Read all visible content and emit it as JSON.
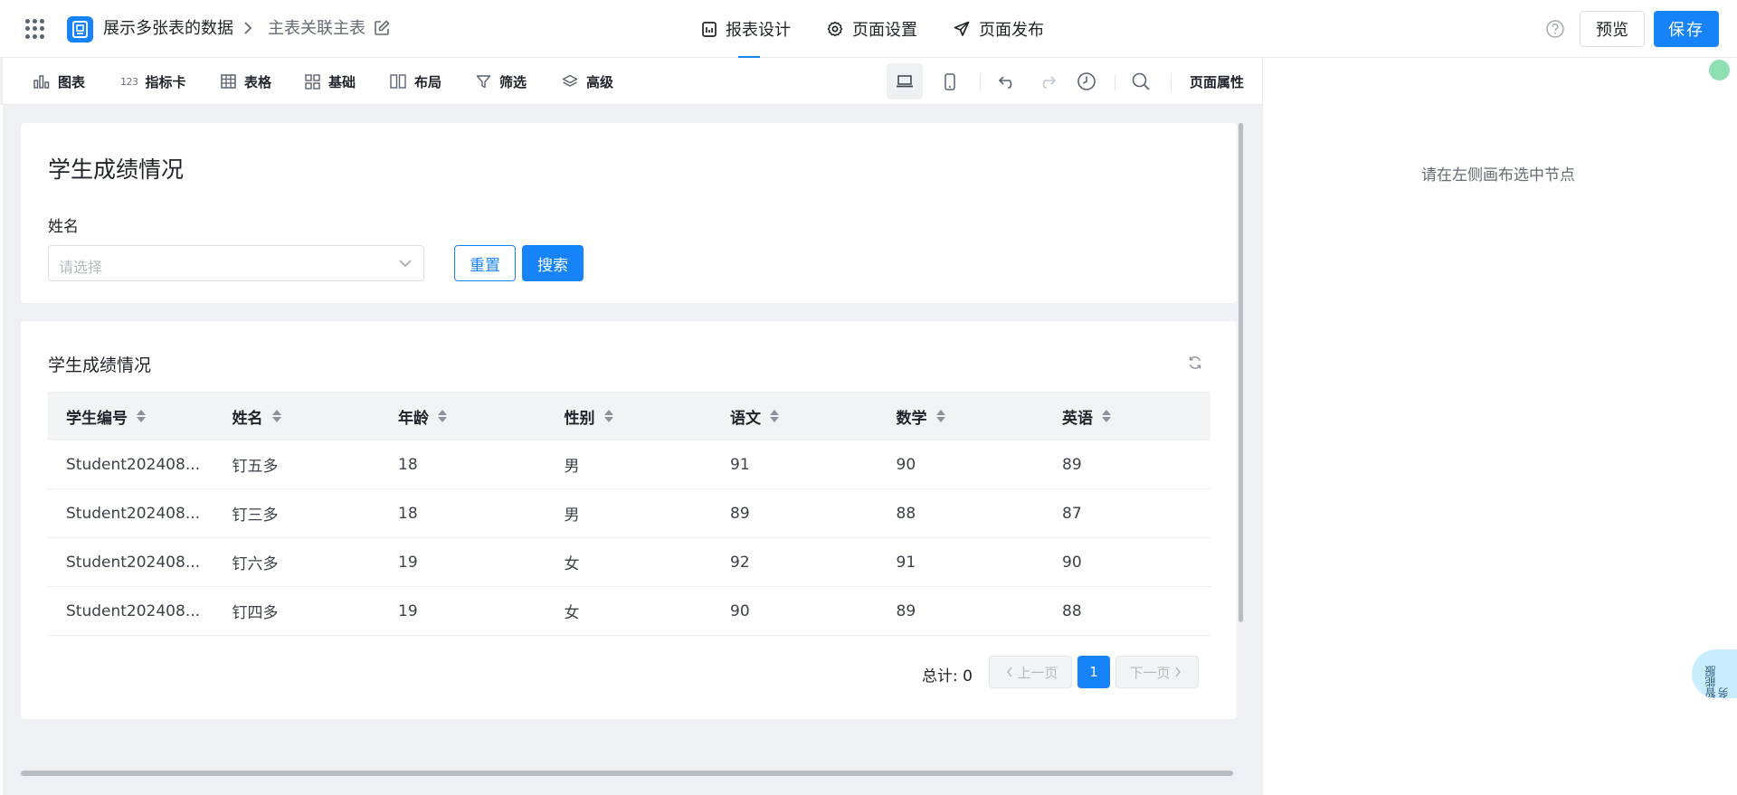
{
  "header": {
    "app_name": "展示多张表的数据",
    "page_name": "主表关联主表",
    "tabs": [
      {
        "label": "报表设计",
        "icon": "report-design-icon"
      },
      {
        "label": "页面设置",
        "icon": "gear-icon"
      },
      {
        "label": "页面发布",
        "icon": "send-icon"
      }
    ],
    "active_tab": "报表设计",
    "preview_label": "预览",
    "save_label": "保存"
  },
  "toolbar": {
    "tools": [
      {
        "label": "图表",
        "icon": "bar-chart-icon"
      },
      {
        "label": "指标卡",
        "icon": "metric-123-icon",
        "glyph": "123"
      },
      {
        "label": "表格",
        "icon": "table-grid-icon"
      },
      {
        "label": "基础",
        "icon": "basic-components-icon"
      },
      {
        "label": "布局",
        "icon": "layout-columns-icon"
      },
      {
        "label": "筛选",
        "icon": "filter-icon"
      },
      {
        "label": "高级",
        "icon": "layers-icon"
      }
    ],
    "page_props_label": "页面属性"
  },
  "filter_card": {
    "title": "学生成绩情况",
    "field_label": "姓名",
    "select_placeholder": "请选择",
    "reset_label": "重置",
    "search_label": "搜索"
  },
  "table_card": {
    "title": "学生成绩情况",
    "columns": [
      "学生编号",
      "姓名",
      "年龄",
      "性别",
      "语文",
      "数学",
      "英语"
    ],
    "rows": [
      [
        "Student202408...",
        "钉五多",
        "18",
        "男",
        "91",
        "90",
        "89"
      ],
      [
        "Student202408...",
        "钉三多",
        "18",
        "男",
        "89",
        "88",
        "87"
      ],
      [
        "Student202408...",
        "钉六多",
        "19",
        "女",
        "92",
        "91",
        "90"
      ],
      [
        "Student202408...",
        "钉四多",
        "19",
        "女",
        "90",
        "89",
        "88"
      ]
    ],
    "pagination": {
      "total_text": "总计: 0",
      "prev_label": "上一页",
      "next_label": "下一页",
      "current_page": "1"
    }
  },
  "right_panel": {
    "hint": "请在左侧画布选中节点"
  },
  "float_service": {
    "label": "智能服务"
  },
  "colors": {
    "primary": "#1683f8",
    "canvas_bg": "#eef0f4",
    "header_bg": "#f2f3f5",
    "status_dot": "#8ee0b3"
  }
}
